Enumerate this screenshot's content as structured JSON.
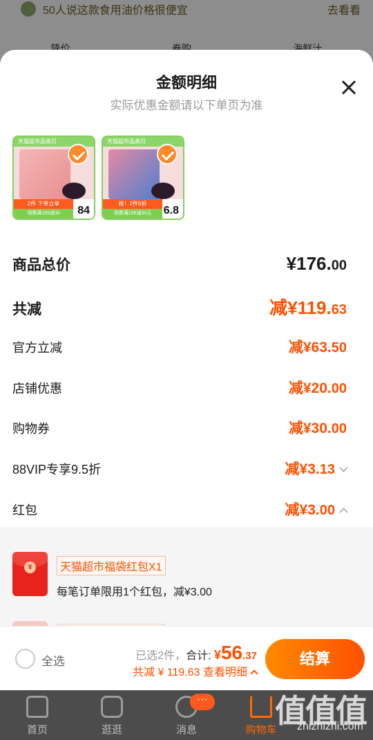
{
  "background": {
    "banner_text": "50人说这款食用油价格很便宜",
    "banner_more": "去看看",
    "filters": [
      "降价",
      "券购",
      "海鲜汁"
    ]
  },
  "sheet": {
    "title": "金额明细",
    "subtitle": "实际优惠金额请以下单页为准",
    "thumbs": [
      {
        "tag": "天猫超市品类日",
        "promo": "2件 下单立享",
        "coupon": "领券满169减30",
        "price": "84"
      },
      {
        "tag": "天猫超市品类日",
        "promo": "抢！2件5折",
        "coupon": "领券满169减30元",
        "price": "6.8"
      }
    ],
    "rows": {
      "total_label": "商品总价",
      "total_int": "¥176.",
      "total_dec": "00",
      "reduce_label": "共减",
      "reduce_int": "减¥119.",
      "reduce_dec": "63",
      "official_label": "官方立减",
      "official_amt": "减¥63.",
      "official_dec": "50",
      "shop_label": "店铺优惠",
      "shop_amt": "减¥20.",
      "shop_dec": "00",
      "coupon_label": "购物券",
      "coupon_amt": "减¥30.",
      "coupon_dec": "00",
      "vip_label": "88VIP专享9.5折",
      "vip_amt": "减¥3.",
      "vip_dec": "13",
      "hongbao_label": "红包",
      "hongbao_amt": "减¥3.",
      "hongbao_dec": "00"
    },
    "redpacket": {
      "name": "天猫超市福袋红包X1",
      "desc": "每笔订单限用1个红包，减¥3.00",
      "coin": "¥"
    }
  },
  "footer": {
    "select_all": "全选",
    "selected": "已选2件，",
    "total_label": "合计: ",
    "currency": "¥",
    "total_int": "56",
    "total_dec": ".37",
    "reduce_text": "共减 ¥ 119.63  查看明细",
    "checkout": "结算"
  },
  "tabbar": {
    "tabs": [
      "首页",
      "逛逛",
      "消息",
      "购物车"
    ],
    "badge": "···"
  },
  "watermark": {
    "logo": "值值值",
    "site": "zhizhizhi.com"
  }
}
